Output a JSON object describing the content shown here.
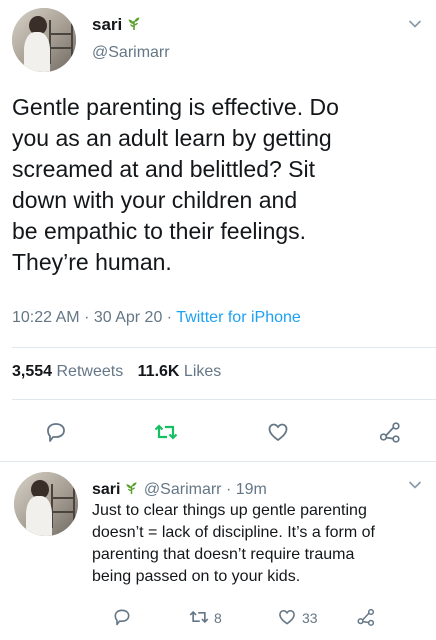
{
  "tweet": {
    "author_name": "sari",
    "author_handle": "@Sarimarr",
    "text_lines": [
      "Gentle parenting is effective. Do",
      "you as an adult learn by getting",
      "screamed at and belittled? Sit",
      "down with your children and",
      "be empathic to their feelings.",
      "They’re human."
    ],
    "time": "10:22 AM",
    "date": "30 Apr 20",
    "separator": "·",
    "source": "Twitter for iPhone",
    "retweets_count": "3,554",
    "retweets_label": "Retweets",
    "likes_count": "11.6K",
    "likes_label": "Likes"
  },
  "reply": {
    "author_name": "sari",
    "author_handle": "@Sarimarr",
    "separator": "·",
    "age": "19m",
    "text_lines": [
      "Just to clear things up gentle parenting",
      "doesn’t = lack of discipline. It’s a form of",
      "parenting that doesn’t require trauma",
      "being passed on to your kids."
    ],
    "retweet_count": "8",
    "like_count": "33"
  },
  "icons": {
    "verified_like": "sprout-icon",
    "menu": "chevron-down-icon",
    "reply": "reply-icon",
    "retweet": "retweet-icon",
    "like": "heart-icon",
    "share": "share-icon"
  },
  "colors": {
    "text": "#14171a",
    "secondary": "#657786",
    "link": "#1da1f2",
    "retweet_green": "#17bf63",
    "sprout_green": "#5aa02c",
    "divider": "#e1e8ed"
  }
}
